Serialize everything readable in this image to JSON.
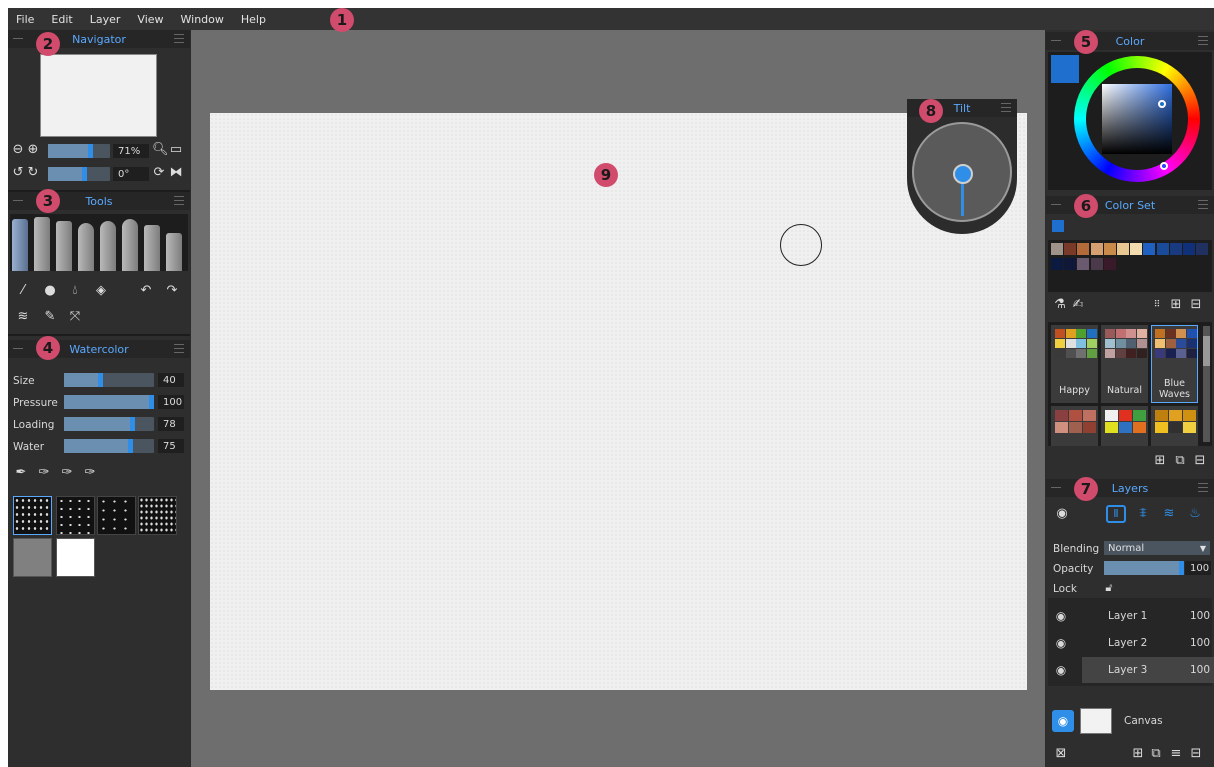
{
  "menu": [
    "File",
    "Edit",
    "Layer",
    "View",
    "Window",
    "Help"
  ],
  "markers": [
    "1",
    "2",
    "3",
    "4",
    "5",
    "6",
    "7",
    "8",
    "9"
  ],
  "navigator": {
    "title": "Navigator",
    "zoom": "71%",
    "rotation": "0°",
    "zoom_level": 0.71,
    "rotation_level": 0.6
  },
  "tools": {
    "title": "Tools"
  },
  "watercolor": {
    "title": "Watercolor",
    "params": [
      {
        "label": "Size",
        "value": "40",
        "level": 0.4
      },
      {
        "label": "Pressure",
        "value": "100",
        "level": 1.0
      },
      {
        "label": "Loading",
        "value": "78",
        "level": 0.78
      },
      {
        "label": "Water",
        "value": "75",
        "level": 0.75
      }
    ]
  },
  "color": {
    "title": "Color",
    "current": "#1f6fcf"
  },
  "colorset": {
    "title": "Color Set",
    "row1": [
      "#a0938a",
      "#7a3a2a",
      "#b56a3a",
      "#d6a070",
      "#c98a4a",
      "#e8c890",
      "#f2dcb0",
      "#2060c0",
      "#1a4a9a",
      "#1a3a80",
      "#10307a",
      "#203060"
    ],
    "row2": [
      "#0a1a40",
      "#10183a",
      "#6a5a70",
      "#4a3a4a",
      "#3a1a2a"
    ],
    "sets": [
      {
        "name": "Happy",
        "colors": [
          "#c05020",
          "#e0a020",
          "#50a030",
          "#2070c0",
          "#f0d040",
          "#e0e0e0",
          "#80c0e0",
          "#a0d060",
          "#3a3a3a",
          "#505050",
          "#707070",
          "#60a040"
        ]
      },
      {
        "name": "Natural",
        "colors": [
          "#9a5a5a",
          "#c07070",
          "#d09090",
          "#e0b0a0",
          "#a0c0d0",
          "#7090a0",
          "#506070",
          "#b09090",
          "#c0a0a0",
          "#604040",
          "#402020",
          "#302020"
        ]
      },
      {
        "name": "Blue Waves",
        "colors": [
          "#c07020",
          "#6a3020",
          "#d09050",
          "#2050b0",
          "#f0c070",
          "#a06040",
          "#2a4a9a",
          "#1a3070",
          "#3a3a7a",
          "#1a2050",
          "#5a6090",
          "#202040"
        ]
      }
    ]
  },
  "layers": {
    "title": "Layers",
    "blending_label": "Blending",
    "blending_value": "Normal",
    "opacity_label": "Opacity",
    "opacity_value": "100",
    "lock_label": "Lock",
    "items": [
      {
        "name": "Layer 1",
        "value": "100"
      },
      {
        "name": "Layer 2",
        "value": "100"
      },
      {
        "name": "Layer 3",
        "value": "100"
      }
    ],
    "canvas_label": "Canvas"
  },
  "tilt": {
    "title": "Tilt"
  },
  "colors": {
    "accent": "#2f8fe8",
    "marker": "#d04b6c",
    "panel_title": "#5aa9ff"
  }
}
